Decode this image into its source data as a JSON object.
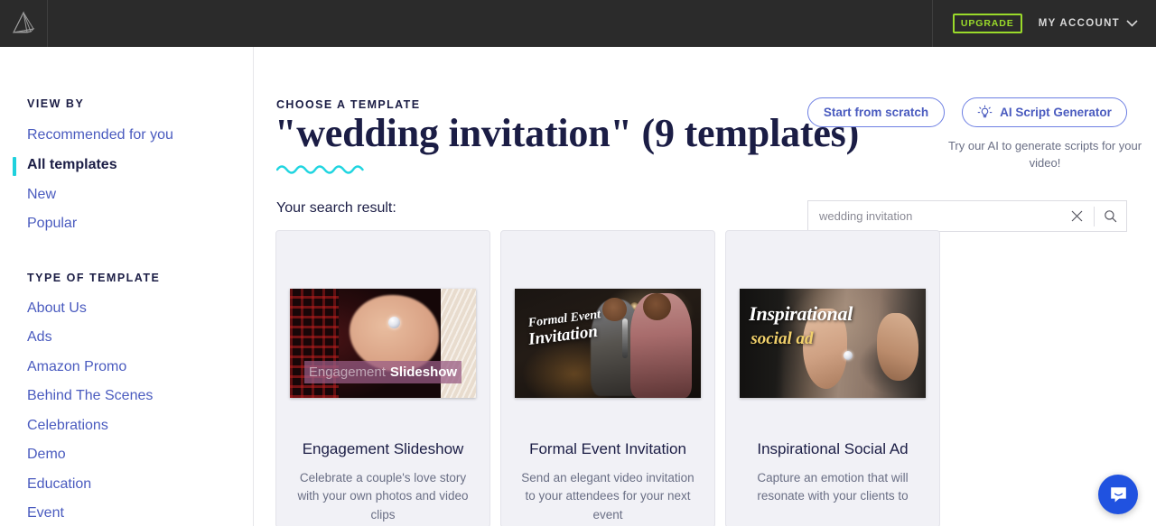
{
  "topbar": {
    "logo_name": "brand-logo",
    "upgrade_label": "UPGRADE",
    "account_label": "MY ACCOUNT",
    "upgrade_color": "#9ada2a",
    "background": "#2b2b2b"
  },
  "sidebar": {
    "view_by_heading": "VIEW BY",
    "view_by_items": [
      {
        "label": "Recommended for you",
        "active": false
      },
      {
        "label": "All templates",
        "active": true
      },
      {
        "label": "New",
        "active": false
      },
      {
        "label": "Popular",
        "active": false
      }
    ],
    "type_heading": "TYPE OF TEMPLATE",
    "type_items": [
      {
        "label": "About Us"
      },
      {
        "label": "Ads"
      },
      {
        "label": "Amazon Promo"
      },
      {
        "label": "Behind The Scenes"
      },
      {
        "label": "Celebrations"
      },
      {
        "label": "Demo"
      },
      {
        "label": "Education"
      },
      {
        "label": "Event"
      }
    ],
    "accent_color": "#1fd1dd",
    "link_color": "#4a5bbf"
  },
  "main": {
    "eyebrow": "CHOOSE A TEMPLATE",
    "title": "\"wedding invitation\" (9 templates)",
    "search_result_label": "Your search result:",
    "start_from_scratch": "Start from scratch",
    "ai_script_generator": "AI Script Generator",
    "ai_caption": "Try our AI to generate scripts for your video!",
    "search_value": "wedding invitation",
    "search_placeholder": "wedding invitation",
    "wave_color": "#20d5e0",
    "title_color": "#1b1d45"
  },
  "templates": [
    {
      "title": "Engagement Slideshow",
      "description": "Celebrate a couple's love story with your own photos and video clips",
      "thumb_text_1": "Engagement",
      "thumb_text_2": "Slideshow",
      "thumb_accent": "#985c84"
    },
    {
      "title": "Formal Event Invitation",
      "description": "Send an elegant video invitation to your attendees for your next event",
      "thumb_text_1": "Formal Event",
      "thumb_text_2": "Invitation",
      "thumb_accent": "#ffffff"
    },
    {
      "title": "Inspirational Social Ad",
      "description": "Capture an emotion that will resonate with your clients to",
      "thumb_text_1": "Inspirational",
      "thumb_text_2": "social ad",
      "thumb_accent": "#f2d16b"
    }
  ],
  "chat": {
    "label": "chat-bubble",
    "color": "#2052e0"
  }
}
